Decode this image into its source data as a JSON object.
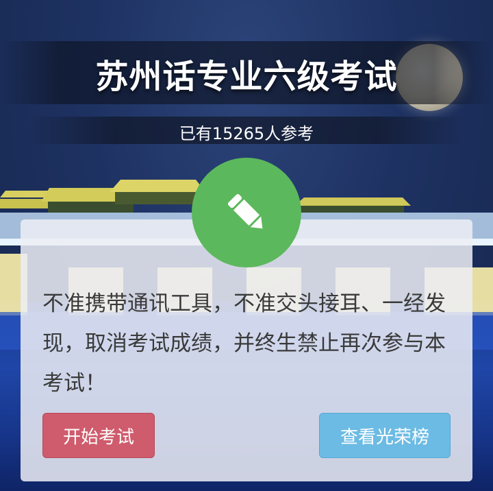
{
  "header": {
    "title": "苏州话专业六级考试",
    "participants": "已有15265人参考"
  },
  "notice": {
    "icon": "pencil-icon",
    "text": "不准携带通讯工具，不准交头接耳、一经发现，取消考试成绩，并终生禁止再次参与本考试！"
  },
  "actions": {
    "start_label": "开始考试",
    "ranking_label": "查看光荣榜"
  },
  "colors": {
    "pencil_circle": "#5cb85c",
    "start_button": "#cf5c6d",
    "ranking_button": "#6cbbe4"
  }
}
